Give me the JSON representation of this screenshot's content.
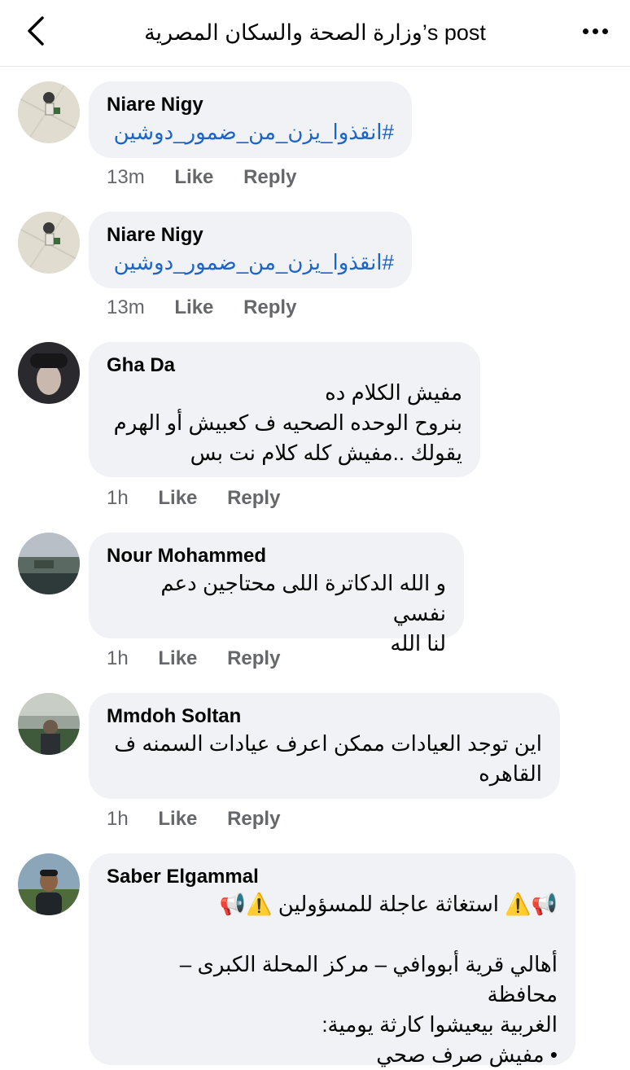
{
  "header": {
    "title": "وزارة الصحة والسكان المصرية’s post"
  },
  "comments": [
    {
      "author": "Niare Nigy",
      "text": "#انقذوا_يزن_من_ضمور_دوشين",
      "time": "13m",
      "like_label": "Like",
      "reply_label": "Reply"
    },
    {
      "author": "Niare Nigy",
      "text": "#انقذوا_يزن_من_ضمور_دوشين",
      "time": "13m",
      "like_label": "Like",
      "reply_label": "Reply"
    },
    {
      "author": "Gha Da",
      "text": "مفيش الكلام ده\nبنروح الوحده الصحيه ف كعبيش أو الهرم\nيقولك ..مفيش كله كلام نت بس",
      "time": "1h",
      "like_label": "Like",
      "reply_label": "Reply"
    },
    {
      "author": "Nour Mohammed",
      "text": "و الله الدكاترة اللى محتاجين دعم نفسي\nلنا الله",
      "time": "1h",
      "like_label": "Like",
      "reply_label": "Reply"
    },
    {
      "author": "Mmdoh Soltan",
      "text": "اين توجد العيادات ممكن اعرف عيادات السمنه ف\nالقاهره",
      "time": "1h",
      "like_label": "Like",
      "reply_label": "Reply"
    },
    {
      "author": "Saber Elgammal",
      "line1": "📢⚠️ استغاثة عاجلة للمسؤولين ⚠️📢",
      "line2": "أهالي قرية أبووافي – مركز المحلة الكبرى – محافظة\nالغربية بيعيشوا كارثة يومية:",
      "line3": "• مفيش صرف صحي"
    }
  ]
}
